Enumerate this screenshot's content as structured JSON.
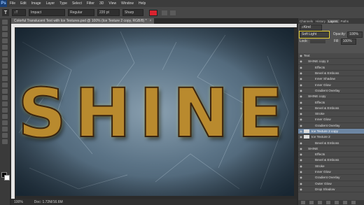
{
  "menu": {
    "app_logo": "Ps",
    "items": [
      "File",
      "Edit",
      "Image",
      "Layer",
      "Type",
      "Select",
      "Filter",
      "3D",
      "View",
      "Window",
      "Help"
    ]
  },
  "options": {
    "font_family": "Impact",
    "font_style": "Regular",
    "font_size": "220 pt",
    "antialias": "Sharp",
    "color_swatch": "#d9232f"
  },
  "document": {
    "tab_title": "Colorful Translucent Text with Ice Textures.psd @ 100% (Ice Texture 2 copy, RGB/8) *",
    "canvas_text": "SHINE",
    "zoom": "100%",
    "doc_info": "Doc: 1.72M/16.6M"
  },
  "panel": {
    "tabs": [
      "Channels",
      "History",
      "Layers",
      "Paths"
    ],
    "active_tab": "Layers",
    "filter_kind": "Kind",
    "blend_mode": "Soft Light",
    "opacity_label": "Opacity:",
    "opacity_value": "100%",
    "lock_label": "Lock:",
    "fill_label": "Fill:",
    "fill_value": "100%",
    "layers": [
      {
        "label": "Text",
        "indent": 0,
        "selected": false,
        "eye": true
      },
      {
        "label": "SHINE copy 2",
        "indent": 1,
        "selected": false,
        "eye": true
      },
      {
        "label": "Effects",
        "indent": 2,
        "selected": false,
        "eye": true
      },
      {
        "label": "Bevel & Emboss",
        "indent": 2,
        "selected": false,
        "eye": true
      },
      {
        "label": "Inner Shadow",
        "indent": 2,
        "selected": false,
        "eye": true
      },
      {
        "label": "Inner Glow",
        "indent": 2,
        "selected": false,
        "eye": true
      },
      {
        "label": "Gradient Overlay",
        "indent": 2,
        "selected": false,
        "eye": true
      },
      {
        "label": "SHINE copy",
        "indent": 1,
        "selected": false,
        "eye": true
      },
      {
        "label": "Effects",
        "indent": 2,
        "selected": false,
        "eye": true
      },
      {
        "label": "Bevel & Emboss",
        "indent": 2,
        "selected": false,
        "eye": true
      },
      {
        "label": "Stroke",
        "indent": 2,
        "selected": false,
        "eye": true
      },
      {
        "label": "Inner Glow",
        "indent": 2,
        "selected": false,
        "eye": true
      },
      {
        "label": "Gradient Overlay",
        "indent": 2,
        "selected": false,
        "eye": true
      },
      {
        "label": "Ice Texture 2 copy",
        "indent": 1,
        "selected": true,
        "eye": true
      },
      {
        "label": "Ice Texture 2",
        "indent": 1,
        "selected": false,
        "eye": true
      },
      {
        "label": "Bevel & Emboss",
        "indent": 2,
        "selected": false,
        "eye": true
      },
      {
        "label": "SHINE",
        "indent": 1,
        "selected": false,
        "eye": true
      },
      {
        "label": "Effects",
        "indent": 2,
        "selected": false,
        "eye": true
      },
      {
        "label": "Bevel & Emboss",
        "indent": 2,
        "selected": false,
        "eye": true
      },
      {
        "label": "Stroke",
        "indent": 2,
        "selected": false,
        "eye": true
      },
      {
        "label": "Inner Glow",
        "indent": 2,
        "selected": false,
        "eye": true
      },
      {
        "label": "Gradient Overlay",
        "indent": 2,
        "selected": false,
        "eye": true
      },
      {
        "label": "Outer Glow",
        "indent": 2,
        "selected": false,
        "eye": true
      },
      {
        "label": "Drop Shadow",
        "indent": 2,
        "selected": false,
        "eye": true
      }
    ]
  }
}
